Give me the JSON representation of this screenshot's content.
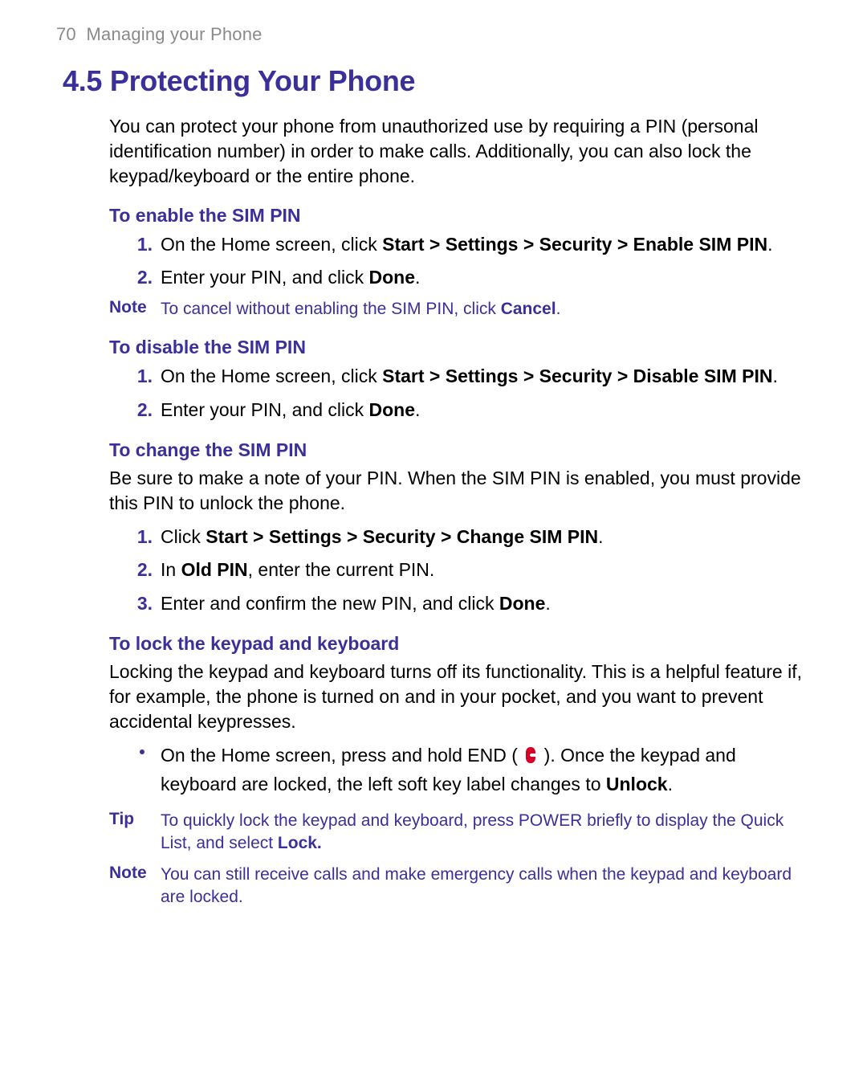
{
  "header": {
    "page_number": "70",
    "chapter_title": "Managing your Phone"
  },
  "section": {
    "number": "4.5",
    "title": "Protecting Your Phone"
  },
  "intro": "You can protect your phone from unauthorized use by requiring a PIN (personal identification number) in order to make calls. Additionally, you can also lock the keypad/keyboard or the entire phone.",
  "sections": {
    "enable_sim": {
      "heading": "To enable the SIM PIN",
      "steps": [
        {
          "num": "1.",
          "pre": "On the Home screen, click ",
          "bold": "Start > Settings > Security > Enable SIM PIN",
          "post": "."
        },
        {
          "num": "2.",
          "pre": "Enter your PIN, and click ",
          "bold": "Done",
          "post": "."
        }
      ],
      "note": {
        "label": "Note",
        "pre": "To cancel without enabling the SIM PIN, click ",
        "bold": "Cancel",
        "post": "."
      }
    },
    "disable_sim": {
      "heading": "To disable the SIM PIN",
      "steps": [
        {
          "num": "1.",
          "pre": "On the Home screen, click ",
          "bold": "Start > Settings > Security > Disable SIM PIN",
          "post": "."
        },
        {
          "num": "2.",
          "pre": "Enter your PIN, and click ",
          "bold": "Done",
          "post": "."
        }
      ]
    },
    "change_sim": {
      "heading": "To change the SIM PIN",
      "intro": "Be sure to make a note of your PIN. When the SIM PIN is enabled, you must provide this PIN to unlock the phone.",
      "steps": [
        {
          "num": "1.",
          "pre": "Click ",
          "bold": "Start > Settings > Security > Change SIM PIN",
          "post": "."
        },
        {
          "num": "2.",
          "pre": "In ",
          "bold": "Old PIN",
          "post": ", enter the current PIN."
        },
        {
          "num": "3.",
          "pre": "Enter and confirm the new PIN, and click ",
          "bold": "Done",
          "post": "."
        }
      ]
    },
    "lock_keypad": {
      "heading": "To lock the keypad and keyboard",
      "intro": "Locking the keypad and keyboard turns off its functionality. This is a helpful feature if, for example, the phone is turned on and in your pocket, and you want to prevent accidental keypresses.",
      "bullet": {
        "pre": "On the Home screen, press and hold END ( ",
        "icon": "end-call-icon",
        "mid": " ). Once the keypad and keyboard are locked, the left soft key label changes to ",
        "bold": "Unlock",
        "post": "."
      },
      "tip": {
        "label": "Tip",
        "pre": "To quickly lock the keypad and keyboard, press POWER briefly to display the Quick List, and select ",
        "bold": "Lock.",
        "post": ""
      },
      "note": {
        "label": "Note",
        "text": "You can still receive calls and make emergency calls when the keypad and keyboard are locked."
      }
    }
  },
  "colors": {
    "accent": "#3b2f9a",
    "end_icon": "#d4002a"
  }
}
